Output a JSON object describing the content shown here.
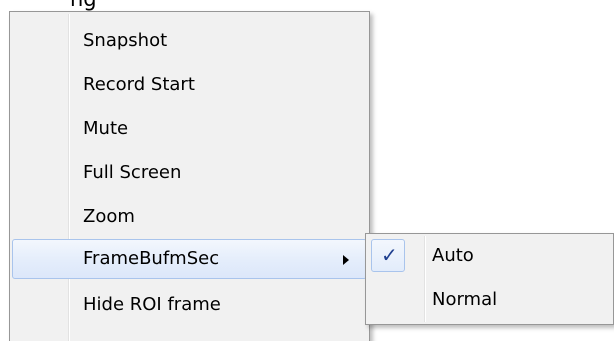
{
  "header_fragment": "ng",
  "context_menu": {
    "items": [
      {
        "label": "Snapshot"
      },
      {
        "label": "Record Start"
      },
      {
        "label": "Mute"
      },
      {
        "label": "Full Screen"
      },
      {
        "label": "Zoom"
      },
      {
        "label": "FrameBufmSec",
        "has_submenu": true,
        "highlighted": true
      },
      {
        "label": "Hide ROI frame"
      }
    ]
  },
  "submenu": {
    "items": [
      {
        "label": "Auto",
        "checked": true
      },
      {
        "label": "Normal",
        "checked": false
      }
    ]
  },
  "icons": {
    "submenu_arrow": "chevron-right-icon",
    "check": "checkmark-icon"
  },
  "colors": {
    "menu_background": "#f1f1f1",
    "highlight_border": "#a9c4ec",
    "highlight_fill": "#e4edfb",
    "check_color": "#1f3f8f"
  }
}
